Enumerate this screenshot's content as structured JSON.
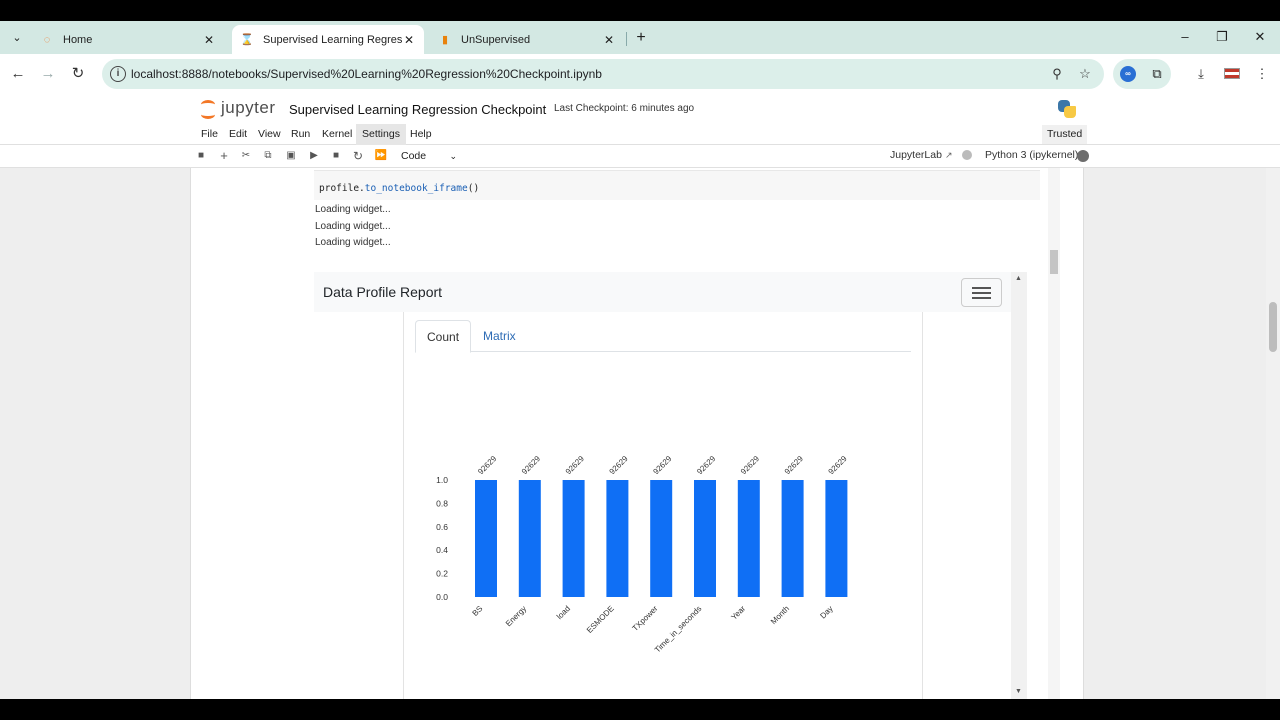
{
  "browser": {
    "tabs": [
      {
        "title": "Home",
        "icon": "jupyter-icon"
      },
      {
        "title": "Supervised Learning Regressio",
        "icon": "hourglass-icon",
        "active": true
      },
      {
        "title": "UnSupervised",
        "icon": "notebook-icon"
      }
    ],
    "url": "localhost:8888/notebooks/Supervised%20Learning%20Regression%20Checkpoint.ipynb"
  },
  "jupyter": {
    "logo_text": "jupyter",
    "notebook_title": "Supervised Learning Regression Checkpoint",
    "checkpoint": "Last Checkpoint: 6 minutes ago",
    "menu": [
      "File",
      "Edit",
      "View",
      "Run",
      "Kernel",
      "Settings",
      "Help"
    ],
    "trusted": "Trusted",
    "cell_type": "Code",
    "jupyterlab_link": "JupyterLab",
    "kernel": "Python 3 (ipykernel)"
  },
  "notebook": {
    "code_obj": "profile.",
    "code_fn": "to_notebook_iframe",
    "code_tail": "()",
    "loading": [
      "Loading widget...",
      "Loading widget...",
      "Loading widget..."
    ]
  },
  "report": {
    "title": "Data Profile Report",
    "tabs": [
      "Count",
      "Matrix"
    ],
    "active_tab": "Count"
  },
  "chart_data": {
    "type": "bar",
    "categories": [
      "BS",
      "Energy",
      "load",
      "ESMODE",
      "TXpower",
      "Time_in_seconds",
      "Year",
      "Month",
      "Day"
    ],
    "values": [
      1.0,
      1.0,
      1.0,
      1.0,
      1.0,
      1.0,
      1.0,
      1.0,
      1.0
    ],
    "top_labels": [
      "92629",
      "92629",
      "92629",
      "92629",
      "92629",
      "92629",
      "92629",
      "92629",
      "92629"
    ],
    "yticks": [
      "0.0",
      "0.2",
      "0.4",
      "0.6",
      "0.8",
      "1.0"
    ],
    "ylim": [
      0,
      1
    ],
    "bar_color": "#0f6ff5",
    "grid": false
  }
}
